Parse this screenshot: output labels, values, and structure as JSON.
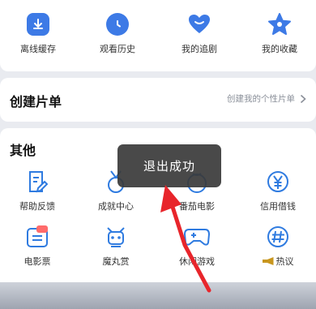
{
  "quick_actions": [
    {
      "label": "离线缓存",
      "icon": "download-icon"
    },
    {
      "label": "观看历史",
      "icon": "clock-icon"
    },
    {
      "label": "我的追剧",
      "icon": "heart-icon"
    },
    {
      "label": "我的收藏",
      "icon": "star-icon"
    }
  ],
  "playlist": {
    "title": "创建片单",
    "link_label": "创建我的个性片单",
    "link_icon": "chevron-right-icon"
  },
  "other": {
    "title": "其他",
    "items": [
      {
        "label": "帮助反馈",
        "icon": "feedback-icon"
      },
      {
        "label": "成就中心",
        "icon": "medal-icon"
      },
      {
        "label": "番茄电影",
        "icon": "tomato-icon"
      },
      {
        "label": "信用借钱",
        "icon": "yuan-icon"
      },
      {
        "label": "电影票",
        "icon": "ticket-icon"
      },
      {
        "label": "魔丸赏",
        "icon": "robot-icon"
      },
      {
        "label": "休闲游戏",
        "icon": "gamepad-icon"
      },
      {
        "label": "热议",
        "icon": "hashtag-icon"
      }
    ]
  },
  "toast": {
    "message": "退出成功"
  },
  "colors": {
    "accent": "#3d7ae6",
    "arrow": "#e8252b",
    "icon_outline": "#2f7be0"
  }
}
